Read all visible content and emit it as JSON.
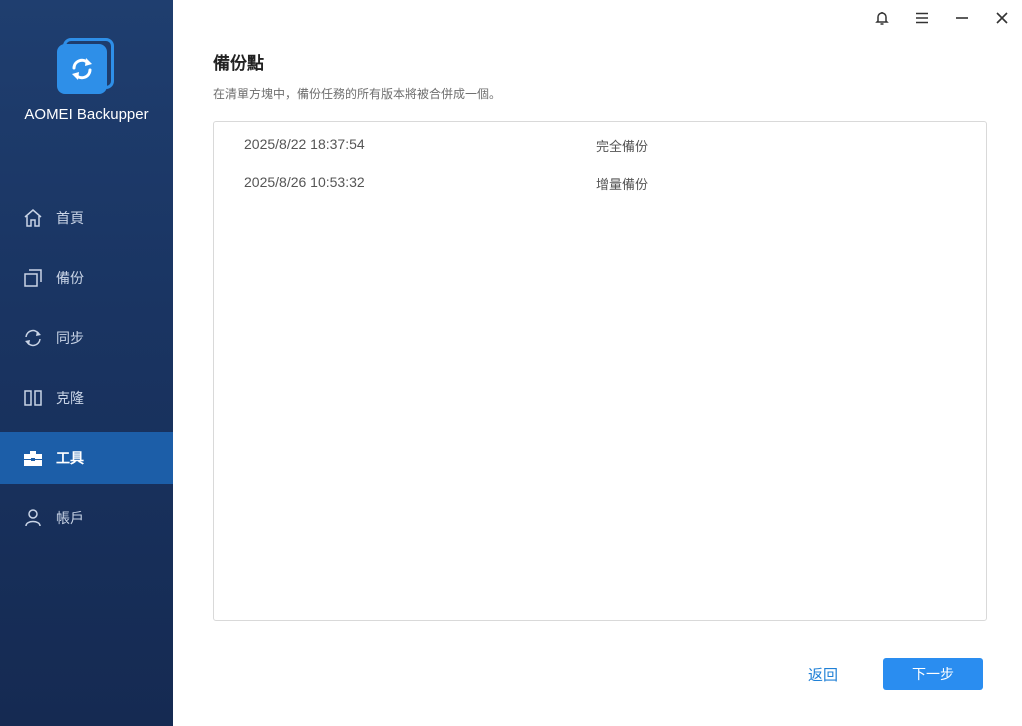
{
  "app": {
    "name": "AOMEI Backupper"
  },
  "sidebar": {
    "items": [
      {
        "label": "首頁",
        "icon": "home-icon",
        "active": false
      },
      {
        "label": "備份",
        "icon": "backup-icon",
        "active": false
      },
      {
        "label": "同步",
        "icon": "sync-icon",
        "active": false
      },
      {
        "label": "克隆",
        "icon": "clone-icon",
        "active": false
      },
      {
        "label": "工具",
        "icon": "toolbox-icon",
        "active": true
      },
      {
        "label": "帳戶",
        "icon": "user-icon",
        "active": false
      }
    ]
  },
  "window_controls": [
    "bell-icon",
    "menu-icon",
    "minimize-icon",
    "close-icon"
  ],
  "main": {
    "title": "備份點",
    "description": "在清單方塊中，備份任務的所有版本將被合併成一個。",
    "rows": [
      {
        "time": "2025/8/22 18:37:54",
        "type": "完全備份"
      },
      {
        "time": "2025/8/26 10:53:32",
        "type": "增量備份"
      }
    ]
  },
  "footer": {
    "back_label": "返回",
    "next_label": "下一步"
  },
  "colors": {
    "sidebar": "#1a3563",
    "active_item": "#1c5ea8",
    "accent": "#2a8df0",
    "link": "#1f80d6"
  }
}
